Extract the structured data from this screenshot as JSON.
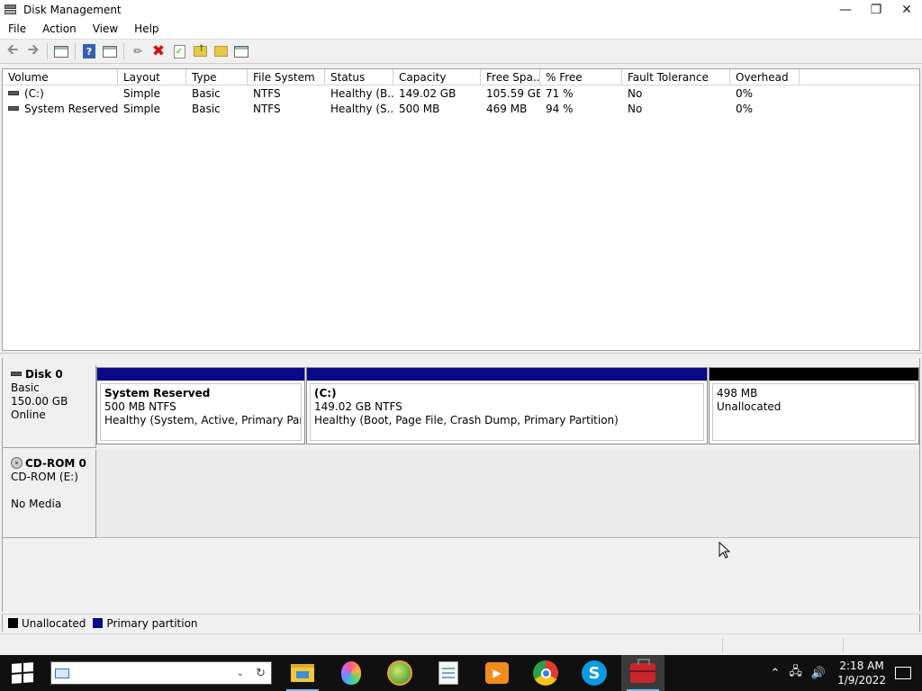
{
  "window": {
    "title": "Disk Management"
  },
  "menu": [
    "File",
    "Action",
    "View",
    "Help"
  ],
  "volume_list": {
    "columns": [
      "Volume",
      "Layout",
      "Type",
      "File System",
      "Status",
      "Capacity",
      "Free Spa...",
      "% Free",
      "Fault Tolerance",
      "Overhead"
    ],
    "rows": [
      [
        "(C:)",
        "Simple",
        "Basic",
        "NTFS",
        "Healthy (B...",
        "149.02 GB",
        "105.59 GB",
        "71 %",
        "No",
        "0%"
      ],
      [
        "System Reserved",
        "Simple",
        "Basic",
        "NTFS",
        "Healthy (S...",
        "500 MB",
        "469 MB",
        "94 %",
        "No",
        "0%"
      ]
    ]
  },
  "disks": {
    "disk0": {
      "name": "Disk 0",
      "type": "Basic",
      "size": "150.00 GB",
      "state": "Online",
      "partitions": [
        {
          "title": "System Reserved",
          "size": "500 MB NTFS",
          "status": "Healthy (System, Active, Primary Partition)",
          "kind": "primary"
        },
        {
          "title": "(C:)",
          "size": "149.02 GB NTFS",
          "status": "Healthy (Boot, Page File, Crash Dump, Primary Partition)",
          "kind": "primary"
        },
        {
          "title": "",
          "size": "498 MB",
          "status": "Unallocated",
          "kind": "unallocated"
        }
      ]
    },
    "cdrom0": {
      "name": "CD-ROM 0",
      "drive": "CD-ROM (E:)",
      "media": "No Media"
    }
  },
  "legend": {
    "items": [
      {
        "label": "Unallocated",
        "color": "#000000"
      },
      {
        "label": "Primary partition",
        "color": "#0a0a88"
      }
    ]
  },
  "colors": {
    "primary": "#0a0a88",
    "unallocated": "#000000"
  },
  "taskbar": {
    "search_placeholder": "",
    "apps": [
      "file-explorer-icon",
      "paint-3d-icon",
      "green-app-icon",
      "notepad-icon",
      "media-player-icon",
      "chrome-icon",
      "skype-icon",
      "toolbox-icon"
    ],
    "clock_time": "2:18 AM",
    "clock_date": "1/9/2022"
  }
}
